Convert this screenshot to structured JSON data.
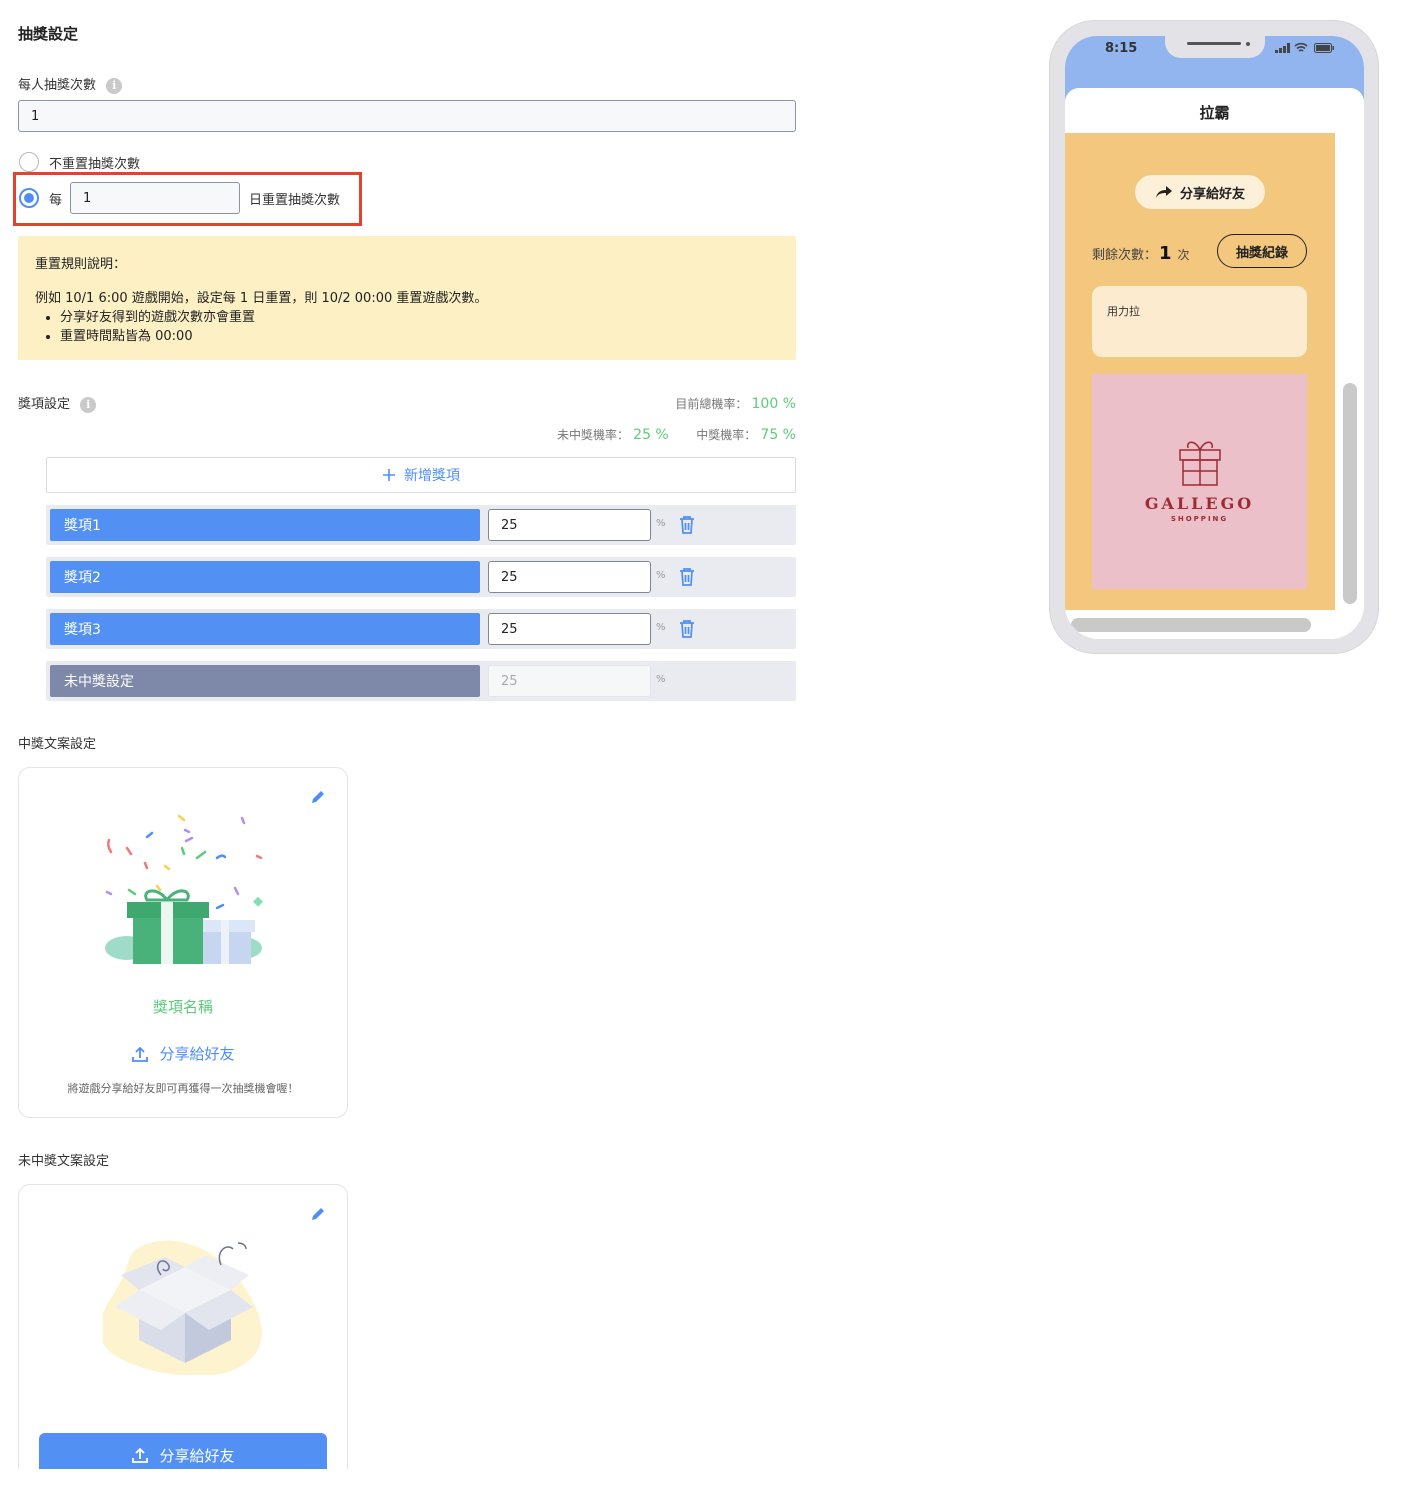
{
  "page": {
    "title": "抽獎設定"
  },
  "draw_count": {
    "label": "每人抽獎次數",
    "value": "1"
  },
  "reset": {
    "option_no_reset": "不重置抽獎次數",
    "option_every_prefix": "每",
    "every_days_value": "1",
    "option_every_suffix": "日重置抽獎次數"
  },
  "note": {
    "title": "重置規則說明：",
    "example": "例如 10/1 6:00 遊戲開始，設定每 1 日重置，則 10/2 00:00 重置遊戲次數。",
    "bullets": [
      "分享好友得到的遊戲次數亦會重置",
      "重置時間點皆為 00:00"
    ]
  },
  "prizes": {
    "section_label": "獎項設定",
    "total_rate_label": "目前總機率：",
    "total_rate_value": "100 %",
    "lose_rate_label": "未中獎機率：",
    "lose_rate_value": "25 %",
    "win_rate_label": "中獎機率：",
    "win_rate_value": "75 %",
    "add_button": "新增獎項",
    "pct_sign": "%",
    "items": [
      {
        "name": "獎項1",
        "pct": "25"
      },
      {
        "name": "獎項2",
        "pct": "25"
      },
      {
        "name": "獎項3",
        "pct": "25"
      }
    ],
    "lose_item": {
      "name": "未中獎設定",
      "pct": "25"
    }
  },
  "win_copy": {
    "section_label": "中獎文案設定",
    "prize_name": "獎項名稱",
    "share_label": "分享給好友",
    "hint": "將遊戲分享給好友即可再獲得一次抽獎機會喔！"
  },
  "lose_copy": {
    "section_label": "未中獎文案設定",
    "share_label": "分享給好友"
  },
  "phone": {
    "time": "8:15",
    "game_title": "拉霸",
    "share_button": "分享給好友",
    "remaining_label": "剩餘次數：",
    "remaining_value": "1",
    "remaining_unit": "次",
    "history_button": "抽獎紀錄",
    "pull_label": "用力拉",
    "brand_name": "GALLEGO",
    "brand_sub": "SHOPPING"
  },
  "colors": {
    "accent": "#5290f4",
    "highlight_border": "#e0442d",
    "rate_green": "#5ccb7a",
    "note_bg": "#fdf0c4",
    "phone_game_bg": "#f4c77e",
    "phone_header": "#92b4ef",
    "brand_tile_bg": "#ecc0c8",
    "brand_color": "#9d2a34"
  },
  "icons": [
    "info-icon",
    "plus-icon",
    "trash-icon",
    "edit-icon",
    "upload-icon",
    "share-arrow-icon",
    "gift-icon",
    "signal-icon",
    "wifi-icon",
    "battery-icon"
  ]
}
